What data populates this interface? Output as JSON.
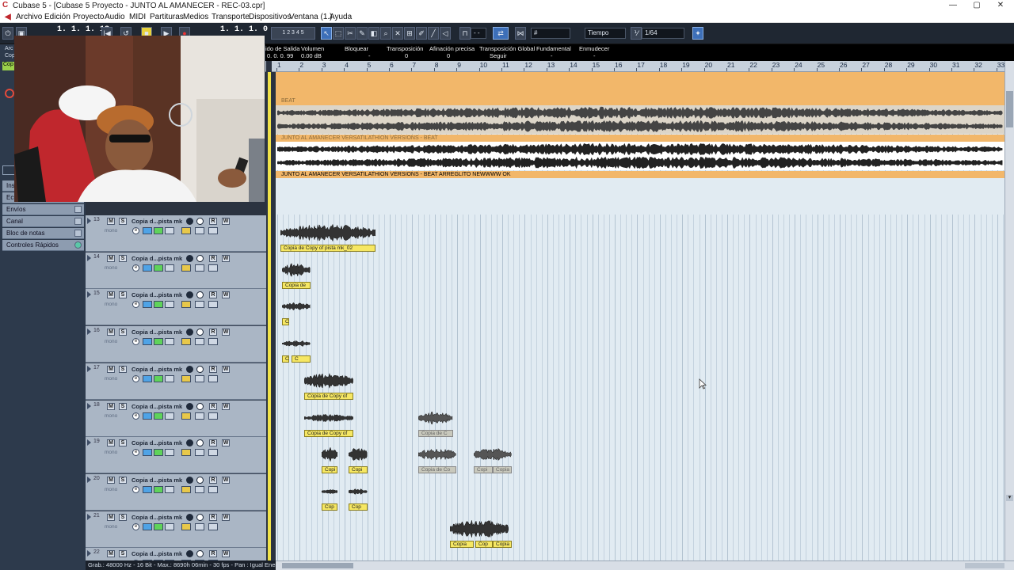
{
  "window": {
    "title": "Cubase 5 - [Cubase 5 Proyecto - JUNTO AL AMANECER - REC-03.cpr]",
    "controls": [
      "—",
      "▢",
      "✕"
    ]
  },
  "menu": [
    "Archivo",
    "Edición",
    "Proyecto",
    "Audio",
    "MIDI",
    "Partituras",
    "Medios",
    "Transporte",
    "Dispositivos",
    "Ventana (1.)",
    "Ayuda"
  ],
  "toolbar": {
    "position_left": "1. 1. 1. 13",
    "position_right": "1. 1. 1.   0",
    "snap_value": "Tiempo",
    "quantize_value": "1/64",
    "nudge_value": "- -",
    "grid_icon": "grid-icon"
  },
  "infoline": {
    "headers": [
      "ido de Salida",
      "Volumen",
      "Bloquear",
      "Transposición",
      "Afinación precisa",
      "Transposición Global",
      "Fundamental",
      "Enmudecer"
    ],
    "values": [
      "0. 0. 0. 99",
      "0.00 dB",
      "-",
      "0",
      "0",
      "Seguir",
      "-",
      "-"
    ]
  },
  "ruler": {
    "bars": [
      "1",
      "2",
      "3",
      "4",
      "5",
      "6",
      "7",
      "8",
      "9",
      "10",
      "11",
      "12",
      "13",
      "14",
      "15",
      "16",
      "17",
      "18",
      "19",
      "20",
      "21",
      "22",
      "23",
      "24",
      "25",
      "26",
      "27",
      "28",
      "29",
      "30",
      "31",
      "32",
      "33"
    ]
  },
  "inspector": {
    "rows": [
      "Ins",
      "Ecu",
      "Envíos",
      "Canal",
      "Bloc de notas",
      "Controles Rápidos"
    ],
    "small_labels": [
      "Arc",
      "Cop",
      "Cop"
    ]
  },
  "upper_parts": [
    {
      "label": "BEAT"
    },
    {
      "label": "JUNTO AL AMANECER VERSATILATHION VERSIONS - BEAT"
    },
    {
      "label": "JUNTO AL AMANECER VERSATILATHION VERSIONS - BEAT ARREGLITO NEWWWW OK"
    }
  ],
  "tracks": [
    {
      "num": "13",
      "name": "Copia d...pista mk",
      "mode": "mono"
    },
    {
      "num": "14",
      "name": "Copia d...pista mk",
      "mode": "mono"
    },
    {
      "num": "15",
      "name": "Copia d...pista mk",
      "mode": "mono"
    },
    {
      "num": "16",
      "name": "Copia d...pista mk",
      "mode": "mono"
    },
    {
      "num": "17",
      "name": "Copia d...pista mk",
      "mode": "mono"
    },
    {
      "num": "18",
      "name": "Copia d...pista mk",
      "mode": "mono"
    },
    {
      "num": "19",
      "name": "Copia d...pista mk",
      "mode": "mono"
    },
    {
      "num": "20",
      "name": "Copia d...pista mk",
      "mode": "mono"
    },
    {
      "num": "21",
      "name": "Copia d...pista mk",
      "mode": "mono"
    },
    {
      "num": "22",
      "name": "Copia d...pista mk",
      "mode": "mono"
    }
  ],
  "track_buttons": {
    "mute": "M",
    "solo": "S",
    "read": "R",
    "write": "W",
    "edit": "e"
  },
  "events": [
    {
      "label": "Copia de Copy of pista mk_02"
    },
    {
      "label": "Copia de"
    },
    {
      "label": "C"
    },
    {
      "label": "C"
    },
    {
      "label": "C"
    },
    {
      "label": "Copia de Copy of"
    },
    {
      "label": "Copia de Copy of"
    },
    {
      "label": "Copia de C"
    },
    {
      "label": "Copi"
    },
    {
      "label": "Copi"
    },
    {
      "label": "Copia de Co"
    },
    {
      "label": "Copi"
    },
    {
      "label": "Copia"
    },
    {
      "label": "Cop"
    },
    {
      "label": "Cop"
    },
    {
      "label": "Copia"
    },
    {
      "label": "Cop"
    },
    {
      "label": "Copia"
    }
  ],
  "statusbar": "Grab.: 48000 Hz - 16 Bit - Max.: 8690h 06min - 30 fps - Pan : Igual Energía",
  "colors": {
    "accent": "#3d6fb8",
    "event_yellow": "#f6e763",
    "part_orange": "#f2b76a",
    "arranger_bg": "#e1ebf2",
    "toolbar_bg": "#1f2732"
  }
}
